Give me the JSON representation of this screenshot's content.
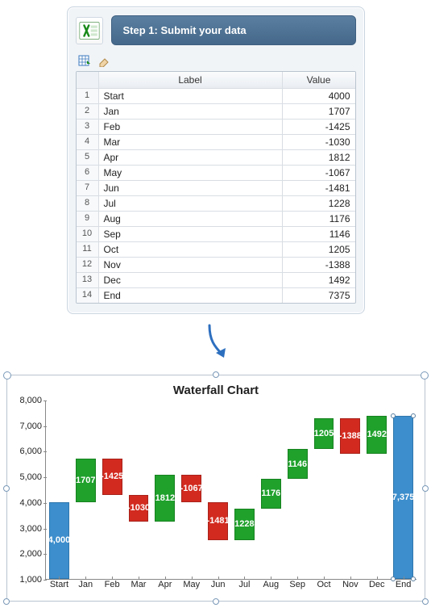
{
  "panel": {
    "step_title": "Step 1: Submit your data",
    "columns": {
      "label": "Label",
      "value": "Value"
    },
    "rows": [
      {
        "n": "1",
        "label": "Start",
        "value": "4000"
      },
      {
        "n": "2",
        "label": "Jan",
        "value": "1707"
      },
      {
        "n": "3",
        "label": "Feb",
        "value": "-1425"
      },
      {
        "n": "4",
        "label": "Mar",
        "value": "-1030"
      },
      {
        "n": "5",
        "label": "Apr",
        "value": "1812"
      },
      {
        "n": "6",
        "label": "May",
        "value": "-1067"
      },
      {
        "n": "7",
        "label": "Jun",
        "value": "-1481"
      },
      {
        "n": "8",
        "label": "Jul",
        "value": "1228"
      },
      {
        "n": "9",
        "label": "Aug",
        "value": "1176"
      },
      {
        "n": "10",
        "label": "Sep",
        "value": "1146"
      },
      {
        "n": "11",
        "label": "Oct",
        "value": "1205"
      },
      {
        "n": "12",
        "label": "Nov",
        "value": "-1388"
      },
      {
        "n": "13",
        "label": "Dec",
        "value": "1492"
      },
      {
        "n": "14",
        "label": "End",
        "value": "7375"
      }
    ]
  },
  "chart_data": {
    "type": "bar",
    "subtype": "waterfall",
    "title": "Waterfall Chart",
    "xlabel": "",
    "ylabel": "",
    "ylim": [
      1000,
      8000
    ],
    "yticks": [
      1000,
      2000,
      3000,
      4000,
      5000,
      6000,
      7000,
      8000
    ],
    "ytick_labels": [
      "1,000",
      "2,000",
      "3,000",
      "4,000",
      "5,000",
      "6,000",
      "7,000",
      "8,000"
    ],
    "categories": [
      "Start",
      "Jan",
      "Feb",
      "Mar",
      "Apr",
      "May",
      "Jun",
      "Jul",
      "Aug",
      "Sep",
      "Oct",
      "Nov",
      "Dec",
      "End"
    ],
    "values": [
      4000,
      1707,
      -1425,
      -1030,
      1812,
      -1067,
      -1481,
      1228,
      1176,
      1146,
      1205,
      -1388,
      1492,
      7375
    ],
    "is_total": [
      true,
      false,
      false,
      false,
      false,
      false,
      false,
      false,
      false,
      false,
      false,
      false,
      false,
      true
    ],
    "data_labels": [
      "4,000",
      "1707",
      "-1425",
      "-1030",
      "1812",
      "-1067",
      "-1481",
      "1228",
      "1176",
      "1146",
      "1205",
      "-1388",
      "1492",
      "7,375"
    ],
    "selected_series": "end_total",
    "colors": {
      "total": "#3d8ecc",
      "positive": "#1fa12c",
      "negative": "#d22a1f"
    }
  }
}
